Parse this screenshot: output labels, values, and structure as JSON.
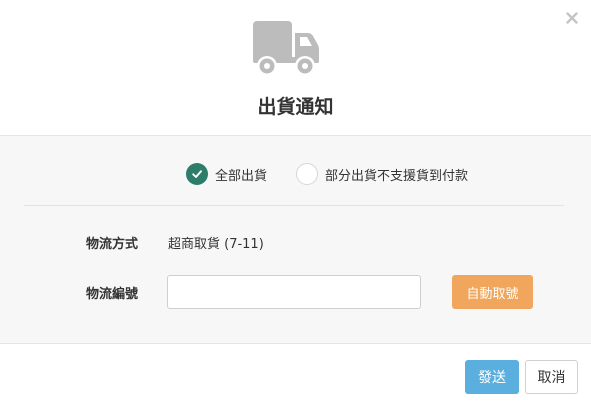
{
  "dialog": {
    "title": "出貨通知",
    "icons": {
      "header": "truck-icon",
      "close": "close-icon",
      "check": "check-icon"
    },
    "colors": {
      "radio_checked": "#2e7d6b",
      "auto_button": "#f0a65c",
      "send_button": "#5aafdf",
      "body_background": "#f7f7f8",
      "truck": "#bcbcbc"
    }
  },
  "shipping_options": [
    {
      "label": "全部出貨",
      "selected": true
    },
    {
      "label": "部分出貨不支援貨到付款",
      "selected": false
    }
  ],
  "form": {
    "logistics_method_label": "物流方式",
    "logistics_method_value": "超商取貨 (7-11)",
    "tracking_number_label": "物流編號",
    "tracking_number_value": "",
    "tracking_number_placeholder": "",
    "auto_fetch_label": "自動取號"
  },
  "footer": {
    "send_label": "發送",
    "cancel_label": "取消"
  }
}
